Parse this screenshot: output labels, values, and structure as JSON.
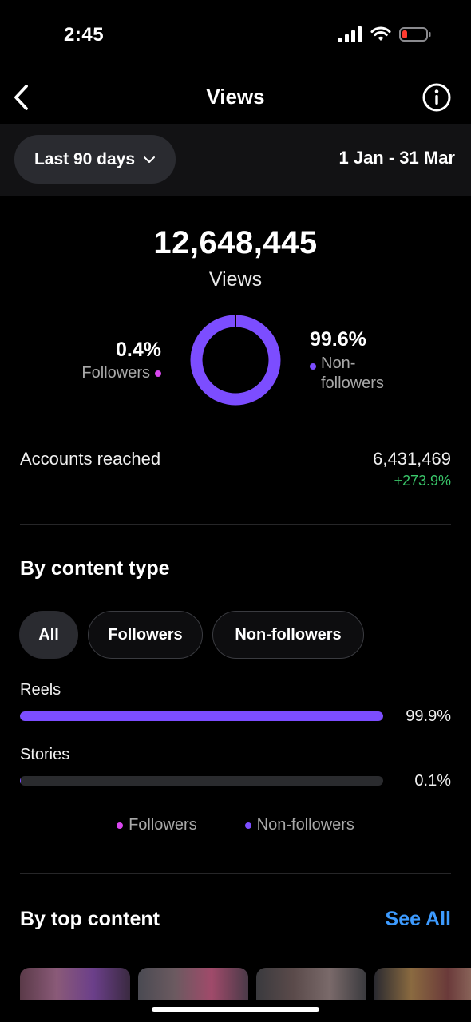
{
  "status_bar": {
    "time": "2:45",
    "icons": [
      "signal-icon",
      "wifi-icon",
      "battery-low-icon"
    ]
  },
  "nav": {
    "title": "Views",
    "back_icon": "chevron-left-icon",
    "info_icon": "info-icon"
  },
  "filter": {
    "date_range_button": "Last 90 days",
    "date_range_label": "1 Jan - 31 Mar"
  },
  "summary": {
    "total_value": "12,648,445",
    "total_label": "Views",
    "followers_pct": "0.4%",
    "followers_label": "Followers",
    "non_followers_pct": "99.6%",
    "non_followers_label": "Non-followers",
    "followers_fraction": 0.004
  },
  "accounts": {
    "label": "Accounts reached",
    "value": "6,431,469",
    "change": "+273.9%"
  },
  "content_type": {
    "title": "By content type",
    "chips": [
      {
        "label": "All",
        "active": true
      },
      {
        "label": "Followers",
        "active": false
      },
      {
        "label": "Non-followers",
        "active": false
      }
    ],
    "rows": [
      {
        "label": "Reels",
        "pct_label": "99.9%",
        "fraction": 0.999
      },
      {
        "label": "Stories",
        "pct_label": "0.1%",
        "fraction": 0.001
      }
    ],
    "legend": [
      "Followers",
      "Non-followers"
    ]
  },
  "top_content": {
    "title": "By top content",
    "see_all": "See All"
  },
  "colors": {
    "accent_purple": "#7c4dff",
    "followers_pink": "#d946ef",
    "positive_green": "#3ac76a",
    "link_blue": "#3d9bff"
  }
}
